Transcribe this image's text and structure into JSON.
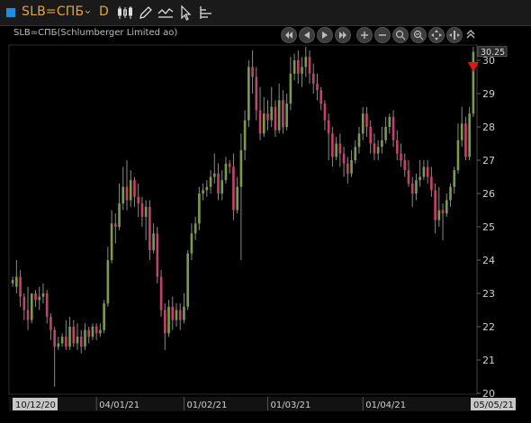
{
  "toolbar": {
    "symbol": "SLB=СПБ",
    "period": "D",
    "icons": [
      "candlestick-chart-icon",
      "pencil-draw-icon",
      "chart-type-icon",
      "cursor-icon",
      "indicators-icon"
    ]
  },
  "chart": {
    "instrument_label": "SLB=СПБ(Schlumberger Limited ao)",
    "last_price_label": "30.25",
    "up_color": "#7a9a4e",
    "down_color": "#c6416a",
    "wick_color": "#8a8a8a",
    "marker_color": "#e01818"
  },
  "nav_buttons": [
    "rewind-icon",
    "step-back-icon",
    "step-forward-icon",
    "fast-forward-icon",
    "zoom-in-icon",
    "zoom-out-icon",
    "zoom-fit-icon",
    "zoom-area-icon",
    "pan-icon",
    "zoom-reset-icon",
    "collapse-up-icon"
  ],
  "chart_data": {
    "type": "candlestick",
    "x_labels": [
      "10/12/20",
      "04/01/21",
      "01/02/21",
      "01/03/21",
      "01/04/21",
      "05/05/21"
    ],
    "y_ticks": [
      20,
      21,
      22,
      23,
      24,
      25,
      26,
      27,
      28,
      29,
      30
    ],
    "ylim": [
      20,
      30.5
    ],
    "grid": false,
    "last_price": 30.25,
    "candles": [
      [
        23.3,
        23.4,
        23.2,
        23.5
      ],
      [
        23.2,
        23.5,
        23.0,
        24.0
      ],
      [
        23.5,
        22.9,
        22.6,
        23.7
      ],
      [
        22.9,
        22.5,
        22.2,
        23.0
      ],
      [
        22.5,
        22.2,
        21.9,
        23.2
      ],
      [
        22.2,
        23.0,
        22.1,
        23.0
      ],
      [
        23.0,
        22.8,
        22.6,
        23.1
      ],
      [
        22.8,
        22.9,
        22.5,
        23.2
      ],
      [
        22.9,
        23.0,
        22.7,
        23.3
      ],
      [
        23.0,
        22.3,
        22.1,
        23.1
      ],
      [
        22.3,
        21.9,
        21.6,
        22.4
      ],
      [
        21.9,
        21.4,
        20.2,
        22.0
      ],
      [
        21.4,
        21.5,
        21.3,
        21.7
      ],
      [
        21.5,
        21.7,
        21.4,
        21.8
      ],
      [
        21.7,
        21.4,
        21.3,
        22.2
      ],
      [
        21.4,
        22.0,
        21.3,
        22.3
      ],
      [
        22.0,
        21.5,
        21.4,
        22.2
      ],
      [
        21.5,
        21.7,
        21.3,
        22.1
      ],
      [
        21.7,
        21.4,
        21.2,
        21.9
      ],
      [
        21.4,
        21.9,
        21.3,
        22.1
      ],
      [
        21.9,
        21.7,
        21.5,
        22.0
      ],
      [
        21.7,
        22.0,
        21.6,
        22.1
      ],
      [
        22.0,
        21.8,
        21.6,
        22.1
      ],
      [
        21.8,
        21.9,
        21.7,
        22.1
      ],
      [
        21.9,
        22.7,
        21.8,
        22.8
      ],
      [
        22.7,
        24.0,
        22.6,
        24.4
      ],
      [
        24.0,
        25.1,
        23.9,
        25.5
      ],
      [
        25.1,
        25.0,
        24.5,
        25.4
      ],
      [
        25.0,
        25.7,
        24.9,
        26.3
      ],
      [
        25.7,
        26.2,
        25.5,
        26.8
      ],
      [
        26.2,
        25.8,
        25.5,
        27.0
      ],
      [
        25.8,
        26.4,
        25.6,
        26.7
      ],
      [
        26.4,
        25.9,
        25.6,
        26.5
      ],
      [
        25.9,
        25.7,
        25.3,
        26.3
      ],
      [
        25.7,
        25.3,
        25.0,
        25.9
      ],
      [
        25.3,
        25.6,
        24.6,
        25.8
      ],
      [
        25.6,
        24.3,
        24.0,
        25.8
      ],
      [
        24.3,
        24.8,
        24.2,
        25.1
      ],
      [
        24.8,
        23.5,
        23.3,
        25.0
      ],
      [
        23.5,
        22.5,
        22.3,
        23.7
      ],
      [
        22.5,
        21.8,
        21.3,
        22.7
      ],
      [
        21.8,
        22.6,
        21.7,
        22.8
      ],
      [
        22.6,
        22.2,
        21.9,
        22.9
      ],
      [
        22.2,
        22.5,
        22.0,
        22.7
      ],
      [
        22.5,
        22.2,
        21.9,
        22.7
      ],
      [
        22.2,
        22.6,
        22.1,
        23.0
      ],
      [
        22.6,
        24.2,
        22.5,
        24.3
      ],
      [
        24.2,
        24.8,
        24.0,
        25.1
      ],
      [
        24.8,
        25.1,
        24.6,
        25.3
      ],
      [
        25.1,
        26.0,
        24.9,
        26.2
      ],
      [
        26.0,
        26.1,
        25.8,
        26.3
      ],
      [
        26.1,
        26.2,
        25.9,
        26.4
      ],
      [
        26.2,
        26.5,
        26.0,
        26.7
      ],
      [
        26.5,
        26.6,
        26.3,
        27.2
      ],
      [
        26.6,
        26.0,
        25.8,
        26.9
      ],
      [
        26.0,
        26.4,
        25.8,
        26.7
      ],
      [
        26.4,
        26.9,
        26.3,
        27.1
      ],
      [
        26.9,
        26.8,
        26.6,
        27.0
      ],
      [
        26.8,
        25.5,
        25.2,
        27.2
      ],
      [
        25.5,
        26.2,
        25.4,
        26.5
      ],
      [
        26.2,
        27.3,
        24.0,
        27.8
      ],
      [
        27.3,
        28.2,
        27.0,
        28.5
      ],
      [
        28.2,
        29.8,
        28.0,
        30.0
      ],
      [
        29.8,
        29.5,
        29.0,
        30.3
      ],
      [
        29.5,
        28.5,
        28.2,
        29.8
      ],
      [
        28.5,
        27.8,
        27.6,
        29.2
      ],
      [
        27.8,
        28.4,
        27.7,
        28.9
      ],
      [
        28.4,
        28.2,
        27.9,
        28.8
      ],
      [
        28.2,
        28.6,
        28.0,
        29.2
      ],
      [
        28.6,
        27.9,
        27.7,
        28.8
      ],
      [
        27.9,
        28.8,
        27.8,
        29.3
      ],
      [
        28.8,
        28.0,
        27.8,
        29.1
      ],
      [
        28.0,
        28.7,
        27.9,
        29.0
      ],
      [
        28.7,
        29.6,
        28.5,
        30.1
      ],
      [
        29.6,
        30.0,
        29.4,
        30.2
      ],
      [
        30.0,
        29.6,
        29.3,
        30.3
      ],
      [
        29.6,
        29.8,
        29.2,
        30.1
      ],
      [
        29.8,
        30.1,
        29.5,
        30.4
      ],
      [
        30.1,
        29.6,
        29.3,
        30.3
      ],
      [
        29.6,
        29.3,
        29.0,
        29.9
      ],
      [
        29.3,
        29.1,
        28.8,
        29.6
      ],
      [
        29.1,
        28.7,
        28.5,
        29.2
      ],
      [
        28.7,
        28.2,
        27.9,
        28.8
      ],
      [
        28.2,
        27.8,
        27.0,
        28.4
      ],
      [
        27.8,
        27.1,
        26.8,
        28.0
      ],
      [
        27.1,
        27.5,
        27.0,
        27.7
      ],
      [
        27.5,
        27.2,
        26.8,
        27.8
      ],
      [
        27.2,
        26.9,
        26.5,
        27.4
      ],
      [
        26.9,
        26.6,
        26.3,
        27.1
      ],
      [
        26.6,
        27.0,
        26.5,
        27.3
      ],
      [
        27.0,
        27.4,
        26.9,
        27.6
      ],
      [
        27.4,
        27.8,
        27.2,
        28.0
      ],
      [
        27.8,
        28.4,
        27.6,
        28.6
      ],
      [
        28.4,
        28.0,
        27.7,
        28.6
      ],
      [
        28.0,
        27.5,
        27.2,
        28.2
      ],
      [
        27.5,
        27.2,
        27.0,
        27.8
      ],
      [
        27.2,
        27.4,
        27.0,
        27.6
      ],
      [
        27.4,
        27.6,
        27.2,
        28.0
      ],
      [
        27.6,
        28.0,
        27.5,
        28.3
      ],
      [
        28.0,
        28.3,
        27.8,
        28.4
      ],
      [
        28.3,
        27.6,
        27.4,
        28.5
      ],
      [
        27.6,
        27.2,
        27.0,
        27.9
      ],
      [
        27.2,
        27.0,
        26.8,
        27.5
      ],
      [
        27.0,
        26.7,
        26.5,
        27.2
      ],
      [
        26.7,
        26.3,
        26.2,
        27.0
      ],
      [
        26.3,
        26.0,
        25.6,
        26.5
      ],
      [
        26.0,
        26.4,
        25.8,
        26.6
      ],
      [
        26.4,
        26.5,
        26.2,
        27.0
      ],
      [
        26.5,
        26.8,
        26.4,
        27.0
      ],
      [
        26.8,
        26.5,
        26.3,
        27.0
      ],
      [
        26.5,
        26.1,
        25.9,
        26.8
      ],
      [
        26.1,
        25.2,
        24.8,
        26.3
      ],
      [
        25.2,
        25.5,
        25.0,
        26.2
      ],
      [
        25.5,
        25.4,
        24.6,
        25.7
      ],
      [
        25.4,
        25.8,
        25.3,
        26.0
      ],
      [
        25.8,
        26.2,
        25.6,
        26.3
      ],
      [
        26.2,
        26.7,
        26.0,
        26.8
      ],
      [
        26.7,
        27.6,
        26.6,
        28.1
      ],
      [
        27.6,
        28.1,
        27.4,
        28.6
      ],
      [
        28.1,
        27.1,
        27.0,
        28.3
      ],
      [
        27.1,
        28.4,
        27.0,
        28.6
      ],
      [
        28.4,
        30.25,
        28.3,
        30.4
      ]
    ]
  }
}
